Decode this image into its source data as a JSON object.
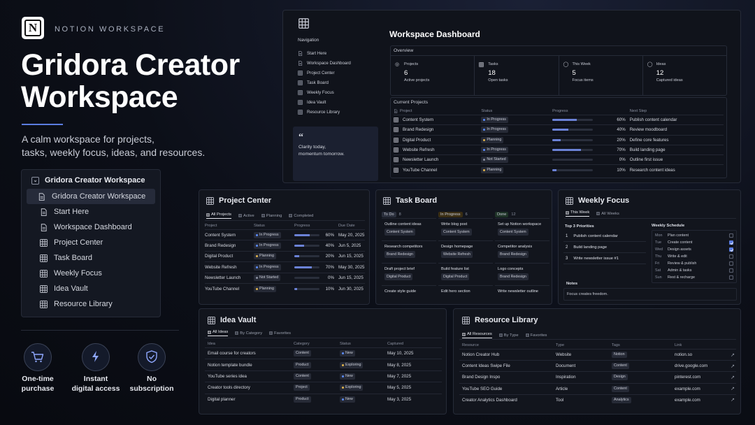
{
  "brand": {
    "kicker": "NOTION WORKSPACE",
    "title_line1": "Gridora Creator",
    "title_line2": "Workspace",
    "tagline_line1": "A calm workspace for projects,",
    "tagline_line2": "tasks, weekly focus, ideas, and resources."
  },
  "tree": {
    "root": "Gridora Creator Workspace",
    "items": [
      "Gridora Creator Workspace",
      "Start Here",
      "Workspace Dashboard",
      "Project Center",
      "Task Board",
      "Weekly Focus",
      "Idea Vault",
      "Resource Library"
    ]
  },
  "features": [
    {
      "icon": "cart-icon",
      "line1": "One-time",
      "line2": "purchase"
    },
    {
      "icon": "bolt-icon",
      "line1": "Instant",
      "line2": "digital access"
    },
    {
      "icon": "shield-check-icon",
      "line1": "No",
      "line2": "subscription"
    }
  ],
  "dashboard": {
    "title": "Workspace Dashboard",
    "nav_title": "Navigation",
    "nav": [
      "Start Here",
      "Workspace Dashboard",
      "Project Center",
      "Task Board",
      "Weekly Focus",
      "Idea Vault",
      "Resource Library"
    ],
    "quote_line1": "Clarity today,",
    "quote_line2": "momentum tomorrow.",
    "overview_title": "Overview",
    "stats": [
      {
        "label": "Projects",
        "value": "6",
        "sub": "Active projects"
      },
      {
        "label": "Tasks",
        "value": "18",
        "sub": "Open tasks"
      },
      {
        "label": "This Week",
        "value": "5",
        "sub": "Focus items"
      },
      {
        "label": "Ideas",
        "value": "12",
        "sub": "Captured ideas"
      }
    ],
    "current_title": "Current Projects",
    "headers": [
      "Project",
      "Status",
      "Progress",
      "Next Step"
    ],
    "rows": [
      {
        "name": "Content System",
        "status": "In Progress",
        "pct": "60%",
        "p": 0.6,
        "next": "Publish content calendar"
      },
      {
        "name": "Brand Redesign",
        "status": "In Progress",
        "pct": "40%",
        "p": 0.4,
        "next": "Review moodboard"
      },
      {
        "name": "Digital Product",
        "status": "Planning",
        "pct": "20%",
        "p": 0.2,
        "next": "Define core features"
      },
      {
        "name": "Website Refresh",
        "status": "In Progress",
        "pct": "70%",
        "p": 0.7,
        "next": "Build landing page"
      },
      {
        "name": "Newsletter Launch",
        "status": "Not Started",
        "pct": "0%",
        "p": 0,
        "next": "Outline first issue"
      },
      {
        "name": "YouTube Channel",
        "status": "Planning",
        "pct": "10%",
        "p": 0.1,
        "next": "Research content ideas"
      }
    ]
  },
  "project_center": {
    "title": "Project Center",
    "tabs": [
      "All Projects",
      "Active",
      "Planning",
      "Completed"
    ],
    "headers": [
      "Project",
      "Status",
      "Progress",
      "Due Date"
    ],
    "rows": [
      {
        "name": "Content System",
        "status": "In Progress",
        "pct": "60%",
        "p": 0.6,
        "due": "May 20, 2025"
      },
      {
        "name": "Brand Redesign",
        "status": "In Progress",
        "pct": "40%",
        "p": 0.4,
        "due": "Jun 5, 2025"
      },
      {
        "name": "Digital Product",
        "status": "Planning",
        "pct": "20%",
        "p": 0.2,
        "due": "Jun 15, 2025"
      },
      {
        "name": "Website Refresh",
        "status": "In Progress",
        "pct": "70%",
        "p": 0.7,
        "due": "May 30, 2025"
      },
      {
        "name": "Newsletter Launch",
        "status": "Not Started",
        "pct": "0%",
        "p": 0,
        "due": "Jun 15, 2025"
      },
      {
        "name": "YouTube Channel",
        "status": "Planning",
        "pct": "10%",
        "p": 0.1,
        "due": "Jun 30, 2025"
      }
    ]
  },
  "task_board": {
    "title": "Task Board",
    "columns": [
      {
        "name": "To Do",
        "count": "8",
        "cards": [
          {
            "t": "Outline content ideas",
            "tag": "Content System"
          },
          {
            "t": "Research competitors",
            "tag": "Brand Redesign"
          },
          {
            "t": "Draft project brief",
            "tag": "Digital Product"
          },
          {
            "t": "Create style guide",
            "tag": ""
          }
        ]
      },
      {
        "name": "In Progress",
        "count": "6",
        "cards": [
          {
            "t": "Write blog post",
            "tag": "Content System"
          },
          {
            "t": "Design homepage",
            "tag": "Website Refresh"
          },
          {
            "t": "Build feature list",
            "tag": "Digital Product"
          },
          {
            "t": "Edit hero section",
            "tag": ""
          }
        ]
      },
      {
        "name": "Done",
        "count": "12",
        "cards": [
          {
            "t": "Set up Notion workspace",
            "tag": "Content System"
          },
          {
            "t": "Competitor analysis",
            "tag": "Brand Redesign"
          },
          {
            "t": "Logo concepts",
            "tag": "Brand Redesign"
          },
          {
            "t": "Write newsletter outline",
            "tag": ""
          }
        ]
      }
    ]
  },
  "weekly_focus": {
    "title": "Weekly Focus",
    "tabs": [
      "This Week",
      "All Weeks"
    ],
    "priorities_title": "Top 3 Priorities",
    "priorities": [
      "Publish content calendar",
      "Build landing page",
      "Write newsletter issue #1"
    ],
    "schedule_title": "Weekly Schedule",
    "schedule": [
      {
        "d": "Mon",
        "t": "Plan content",
        "c": false
      },
      {
        "d": "Tue",
        "t": "Create content",
        "c": true
      },
      {
        "d": "Wed",
        "t": "Design assets",
        "c": true
      },
      {
        "d": "Thu",
        "t": "Write & edit",
        "c": false
      },
      {
        "d": "Fri",
        "t": "Review & publish",
        "c": false
      },
      {
        "d": "Sat",
        "t": "Admin & tasks",
        "c": false
      },
      {
        "d": "Sun",
        "t": "Rest & recharge",
        "c": false
      }
    ],
    "notes_title": "Notes",
    "notes": "Focus creates freedom."
  },
  "idea_vault": {
    "title": "Idea Vault",
    "tabs": [
      "All Ideas",
      "By Category",
      "Favorites"
    ],
    "headers": [
      "Idea",
      "Category",
      "Status",
      "Captured"
    ],
    "rows": [
      {
        "idea": "Email course for creators",
        "cat": "Content",
        "status": "New",
        "date": "May 10, 2025"
      },
      {
        "idea": "Notion template bundle",
        "cat": "Product",
        "status": "Exploring",
        "date": "May 8, 2025"
      },
      {
        "idea": "YouTube series idea",
        "cat": "Content",
        "status": "New",
        "date": "May 7, 2025"
      },
      {
        "idea": "Creator tools directory",
        "cat": "Project",
        "status": "Exploring",
        "date": "May 5, 2025"
      },
      {
        "idea": "Digital planner",
        "cat": "Product",
        "status": "New",
        "date": "May 3, 2025"
      }
    ]
  },
  "resource_library": {
    "title": "Resource Library",
    "tabs": [
      "All Resources",
      "By Type",
      "Favorites"
    ],
    "headers": [
      "Resource",
      "Type",
      "Tags",
      "Link"
    ],
    "rows": [
      {
        "r": "Notion Creator Hub",
        "type": "Website",
        "tag": "Notion",
        "link": "notion.so"
      },
      {
        "r": "Content Ideas Swipe File",
        "type": "Document",
        "tag": "Content",
        "link": "drive.google.com"
      },
      {
        "r": "Brand Design Inspo",
        "type": "Inspiration",
        "tag": "Design",
        "link": "pinterest.com"
      },
      {
        "r": "YouTube SEO Guide",
        "type": "Article",
        "tag": "Content",
        "link": "example.com"
      },
      {
        "r": "Creator Analytics Dashboard",
        "type": "Tool",
        "tag": "Analytics",
        "link": "example.com"
      }
    ]
  },
  "colors": {
    "in_progress": "#5b8cff",
    "planning": "#e0b34a",
    "not_started": "#8a90a0",
    "new": "#5b8cff",
    "exploring": "#e0b34a",
    "accent": "#6b82d6"
  }
}
